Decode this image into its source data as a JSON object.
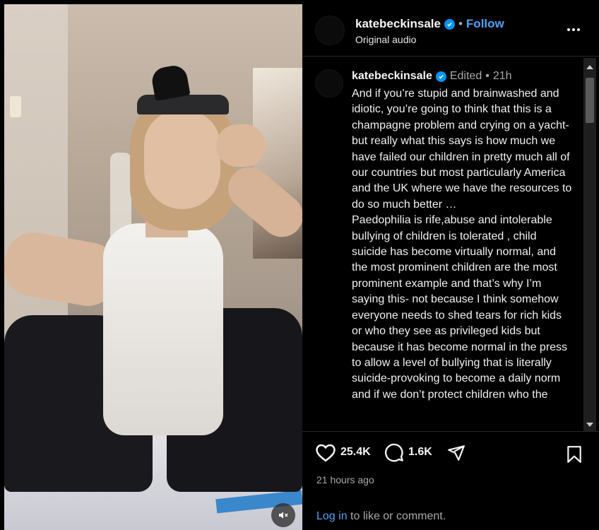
{
  "header": {
    "username": "katebeckinsale",
    "separator": "•",
    "follow_label": "Follow",
    "subtitle": "Original audio",
    "more_icon": "more-horizontal-icon"
  },
  "caption": {
    "username": "katebeckinsale",
    "edited": "Edited",
    "separator": "•",
    "time": "21h",
    "text": "And if you’re stupid and brainwashed and idiotic, you’re going to think that this is a champagne problem and crying on a yacht- but really what this says is how much we have failed our children in pretty much all of our countries but most particularly America and the UK where we have the resources to do so much better …\nPaedophilia is rife,abuse and intolerable bullying of children is tolerated , child suicide has become virtually normal, and the most prominent children are the most prominent example and that’s why I’m saying this- not because I think somehow everyone needs to shed tears for rich kids or who they see as privileged kids but because it has become normal in the press to allow a level of bullying that is literally suicide-provoking to become a daily norm and if we don’t protect children who the"
  },
  "actions": {
    "likes": "25.4K",
    "comments": "1.6K"
  },
  "timeago": "21 hours ago",
  "footer": {
    "login_label": "Log in",
    "rest": " to like or comment."
  },
  "colors": {
    "accent": "#4ca3f5",
    "verified": "#0095f6",
    "background": "#000000",
    "secondary_text": "#a8a8a8"
  }
}
